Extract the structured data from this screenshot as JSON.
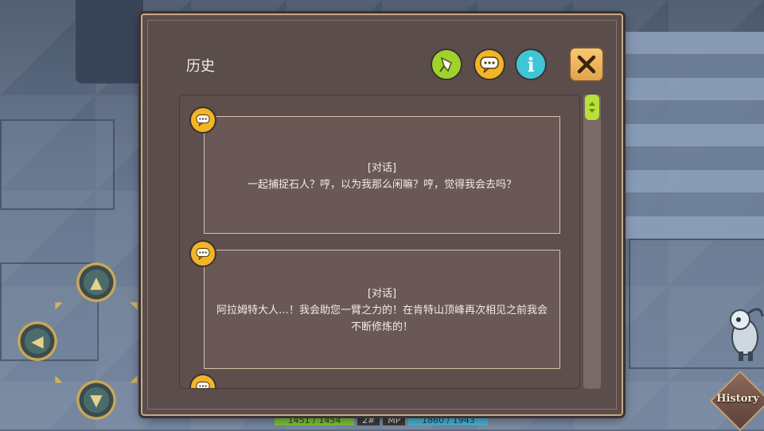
{
  "panel": {
    "title": "历史",
    "header_icons": [
      "pin-icon",
      "chat-bubble-icon",
      "info-icon"
    ],
    "info_glyph": "i",
    "close_icon": "close-icon"
  },
  "entries": [
    {
      "type": "[对话]",
      "text": "一起捕捉石人？哼，以为我那么闲嘛？哼，觉得我会去吗？"
    },
    {
      "type": "[对话]",
      "text": "阿拉姆特大人…！我会助您一臂之力的！在肯特山顶峰再次相见之前我会不断修炼的！"
    },
    {
      "type": "",
      "text": ""
    }
  ],
  "status": {
    "hp": "1451 / 1454",
    "mid": "2#",
    "mp_label": "MP",
    "mp": "1860 / 1943"
  },
  "history_button": {
    "label": "History"
  },
  "colors": {
    "panel_bg": "#5b4d4b",
    "panel_border": "#c7a98a",
    "pin": "#9fd22a",
    "chat": "#f2b526",
    "info": "#3ec6d6",
    "close": "#f0b45c",
    "hp": "#7cc23a",
    "mp": "#49b4d4"
  }
}
